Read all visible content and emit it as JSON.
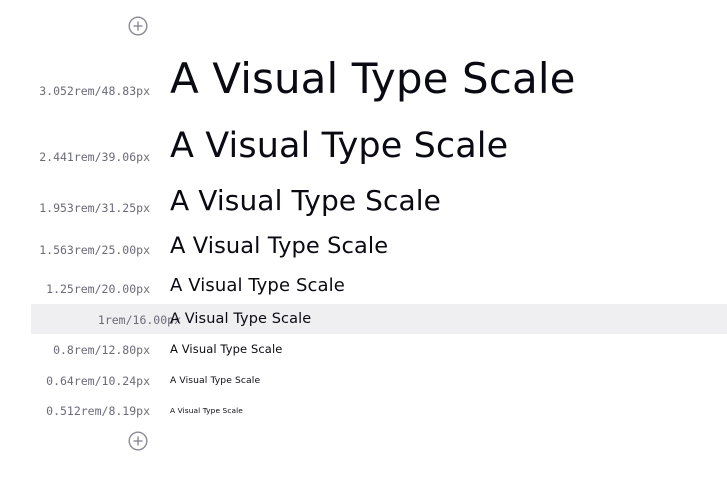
{
  "controls": {
    "add_top_icon": "plus-circle-icon",
    "add_bottom_icon": "plus-circle-icon",
    "icon_color": "#8a8a96"
  },
  "scale": {
    "sample_text": "A Visual Type Scale",
    "highlight_color": "#efeff2",
    "rows": [
      {
        "label": "3.052rem/48.83px",
        "sample": "A Visual Type Scale",
        "selected": false
      },
      {
        "label": "2.441rem/39.06px",
        "sample": "A Visual Type Scale",
        "selected": false
      },
      {
        "label": "1.953rem/31.25px",
        "sample": "A Visual Type Scale",
        "selected": false
      },
      {
        "label": "1.563rem/25.00px",
        "sample": "A Visual Type Scale",
        "selected": false
      },
      {
        "label": "1.25rem/20.00px",
        "sample": "A Visual Type Scale",
        "selected": false
      },
      {
        "label": "1rem/16.00px",
        "sample": "A Visual Type Scale",
        "selected": true
      },
      {
        "label": "0.8rem/12.80px",
        "sample": "A Visual Type Scale",
        "selected": false
      },
      {
        "label": "0.64rem/10.24px",
        "sample": "A Visual Type Scale",
        "selected": false
      },
      {
        "label": "0.512rem/8.19px",
        "sample": "A Visual Type Scale",
        "selected": false
      }
    ]
  }
}
